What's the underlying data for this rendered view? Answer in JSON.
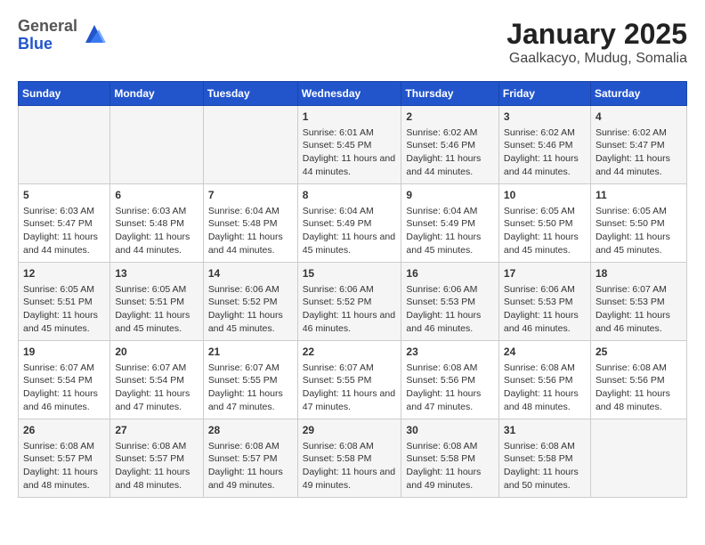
{
  "header": {
    "logo": {
      "general": "General",
      "blue": "Blue"
    },
    "title": "January 2025",
    "subtitle": "Gaalkacyo, Mudug, Somalia"
  },
  "weekdays": [
    "Sunday",
    "Monday",
    "Tuesday",
    "Wednesday",
    "Thursday",
    "Friday",
    "Saturday"
  ],
  "weeks": [
    [
      {
        "day": "",
        "sunrise": "",
        "sunset": "",
        "daylight": ""
      },
      {
        "day": "",
        "sunrise": "",
        "sunset": "",
        "daylight": ""
      },
      {
        "day": "",
        "sunrise": "",
        "sunset": "",
        "daylight": ""
      },
      {
        "day": "1",
        "sunrise": "Sunrise: 6:01 AM",
        "sunset": "Sunset: 5:45 PM",
        "daylight": "Daylight: 11 hours and 44 minutes."
      },
      {
        "day": "2",
        "sunrise": "Sunrise: 6:02 AM",
        "sunset": "Sunset: 5:46 PM",
        "daylight": "Daylight: 11 hours and 44 minutes."
      },
      {
        "day": "3",
        "sunrise": "Sunrise: 6:02 AM",
        "sunset": "Sunset: 5:46 PM",
        "daylight": "Daylight: 11 hours and 44 minutes."
      },
      {
        "day": "4",
        "sunrise": "Sunrise: 6:02 AM",
        "sunset": "Sunset: 5:47 PM",
        "daylight": "Daylight: 11 hours and 44 minutes."
      }
    ],
    [
      {
        "day": "5",
        "sunrise": "Sunrise: 6:03 AM",
        "sunset": "Sunset: 5:47 PM",
        "daylight": "Daylight: 11 hours and 44 minutes."
      },
      {
        "day": "6",
        "sunrise": "Sunrise: 6:03 AM",
        "sunset": "Sunset: 5:48 PM",
        "daylight": "Daylight: 11 hours and 44 minutes."
      },
      {
        "day": "7",
        "sunrise": "Sunrise: 6:04 AM",
        "sunset": "Sunset: 5:48 PM",
        "daylight": "Daylight: 11 hours and 44 minutes."
      },
      {
        "day": "8",
        "sunrise": "Sunrise: 6:04 AM",
        "sunset": "Sunset: 5:49 PM",
        "daylight": "Daylight: 11 hours and 45 minutes."
      },
      {
        "day": "9",
        "sunrise": "Sunrise: 6:04 AM",
        "sunset": "Sunset: 5:49 PM",
        "daylight": "Daylight: 11 hours and 45 minutes."
      },
      {
        "day": "10",
        "sunrise": "Sunrise: 6:05 AM",
        "sunset": "Sunset: 5:50 PM",
        "daylight": "Daylight: 11 hours and 45 minutes."
      },
      {
        "day": "11",
        "sunrise": "Sunrise: 6:05 AM",
        "sunset": "Sunset: 5:50 PM",
        "daylight": "Daylight: 11 hours and 45 minutes."
      }
    ],
    [
      {
        "day": "12",
        "sunrise": "Sunrise: 6:05 AM",
        "sunset": "Sunset: 5:51 PM",
        "daylight": "Daylight: 11 hours and 45 minutes."
      },
      {
        "day": "13",
        "sunrise": "Sunrise: 6:05 AM",
        "sunset": "Sunset: 5:51 PM",
        "daylight": "Daylight: 11 hours and 45 minutes."
      },
      {
        "day": "14",
        "sunrise": "Sunrise: 6:06 AM",
        "sunset": "Sunset: 5:52 PM",
        "daylight": "Daylight: 11 hours and 45 minutes."
      },
      {
        "day": "15",
        "sunrise": "Sunrise: 6:06 AM",
        "sunset": "Sunset: 5:52 PM",
        "daylight": "Daylight: 11 hours and 46 minutes."
      },
      {
        "day": "16",
        "sunrise": "Sunrise: 6:06 AM",
        "sunset": "Sunset: 5:53 PM",
        "daylight": "Daylight: 11 hours and 46 minutes."
      },
      {
        "day": "17",
        "sunrise": "Sunrise: 6:06 AM",
        "sunset": "Sunset: 5:53 PM",
        "daylight": "Daylight: 11 hours and 46 minutes."
      },
      {
        "day": "18",
        "sunrise": "Sunrise: 6:07 AM",
        "sunset": "Sunset: 5:53 PM",
        "daylight": "Daylight: 11 hours and 46 minutes."
      }
    ],
    [
      {
        "day": "19",
        "sunrise": "Sunrise: 6:07 AM",
        "sunset": "Sunset: 5:54 PM",
        "daylight": "Daylight: 11 hours and 46 minutes."
      },
      {
        "day": "20",
        "sunrise": "Sunrise: 6:07 AM",
        "sunset": "Sunset: 5:54 PM",
        "daylight": "Daylight: 11 hours and 47 minutes."
      },
      {
        "day": "21",
        "sunrise": "Sunrise: 6:07 AM",
        "sunset": "Sunset: 5:55 PM",
        "daylight": "Daylight: 11 hours and 47 minutes."
      },
      {
        "day": "22",
        "sunrise": "Sunrise: 6:07 AM",
        "sunset": "Sunset: 5:55 PM",
        "daylight": "Daylight: 11 hours and 47 minutes."
      },
      {
        "day": "23",
        "sunrise": "Sunrise: 6:08 AM",
        "sunset": "Sunset: 5:56 PM",
        "daylight": "Daylight: 11 hours and 47 minutes."
      },
      {
        "day": "24",
        "sunrise": "Sunrise: 6:08 AM",
        "sunset": "Sunset: 5:56 PM",
        "daylight": "Daylight: 11 hours and 48 minutes."
      },
      {
        "day": "25",
        "sunrise": "Sunrise: 6:08 AM",
        "sunset": "Sunset: 5:56 PM",
        "daylight": "Daylight: 11 hours and 48 minutes."
      }
    ],
    [
      {
        "day": "26",
        "sunrise": "Sunrise: 6:08 AM",
        "sunset": "Sunset: 5:57 PM",
        "daylight": "Daylight: 11 hours and 48 minutes."
      },
      {
        "day": "27",
        "sunrise": "Sunrise: 6:08 AM",
        "sunset": "Sunset: 5:57 PM",
        "daylight": "Daylight: 11 hours and 48 minutes."
      },
      {
        "day": "28",
        "sunrise": "Sunrise: 6:08 AM",
        "sunset": "Sunset: 5:57 PM",
        "daylight": "Daylight: 11 hours and 49 minutes."
      },
      {
        "day": "29",
        "sunrise": "Sunrise: 6:08 AM",
        "sunset": "Sunset: 5:58 PM",
        "daylight": "Daylight: 11 hours and 49 minutes."
      },
      {
        "day": "30",
        "sunrise": "Sunrise: 6:08 AM",
        "sunset": "Sunset: 5:58 PM",
        "daylight": "Daylight: 11 hours and 49 minutes."
      },
      {
        "day": "31",
        "sunrise": "Sunrise: 6:08 AM",
        "sunset": "Sunset: 5:58 PM",
        "daylight": "Daylight: 11 hours and 50 minutes."
      },
      {
        "day": "",
        "sunrise": "",
        "sunset": "",
        "daylight": ""
      }
    ]
  ]
}
